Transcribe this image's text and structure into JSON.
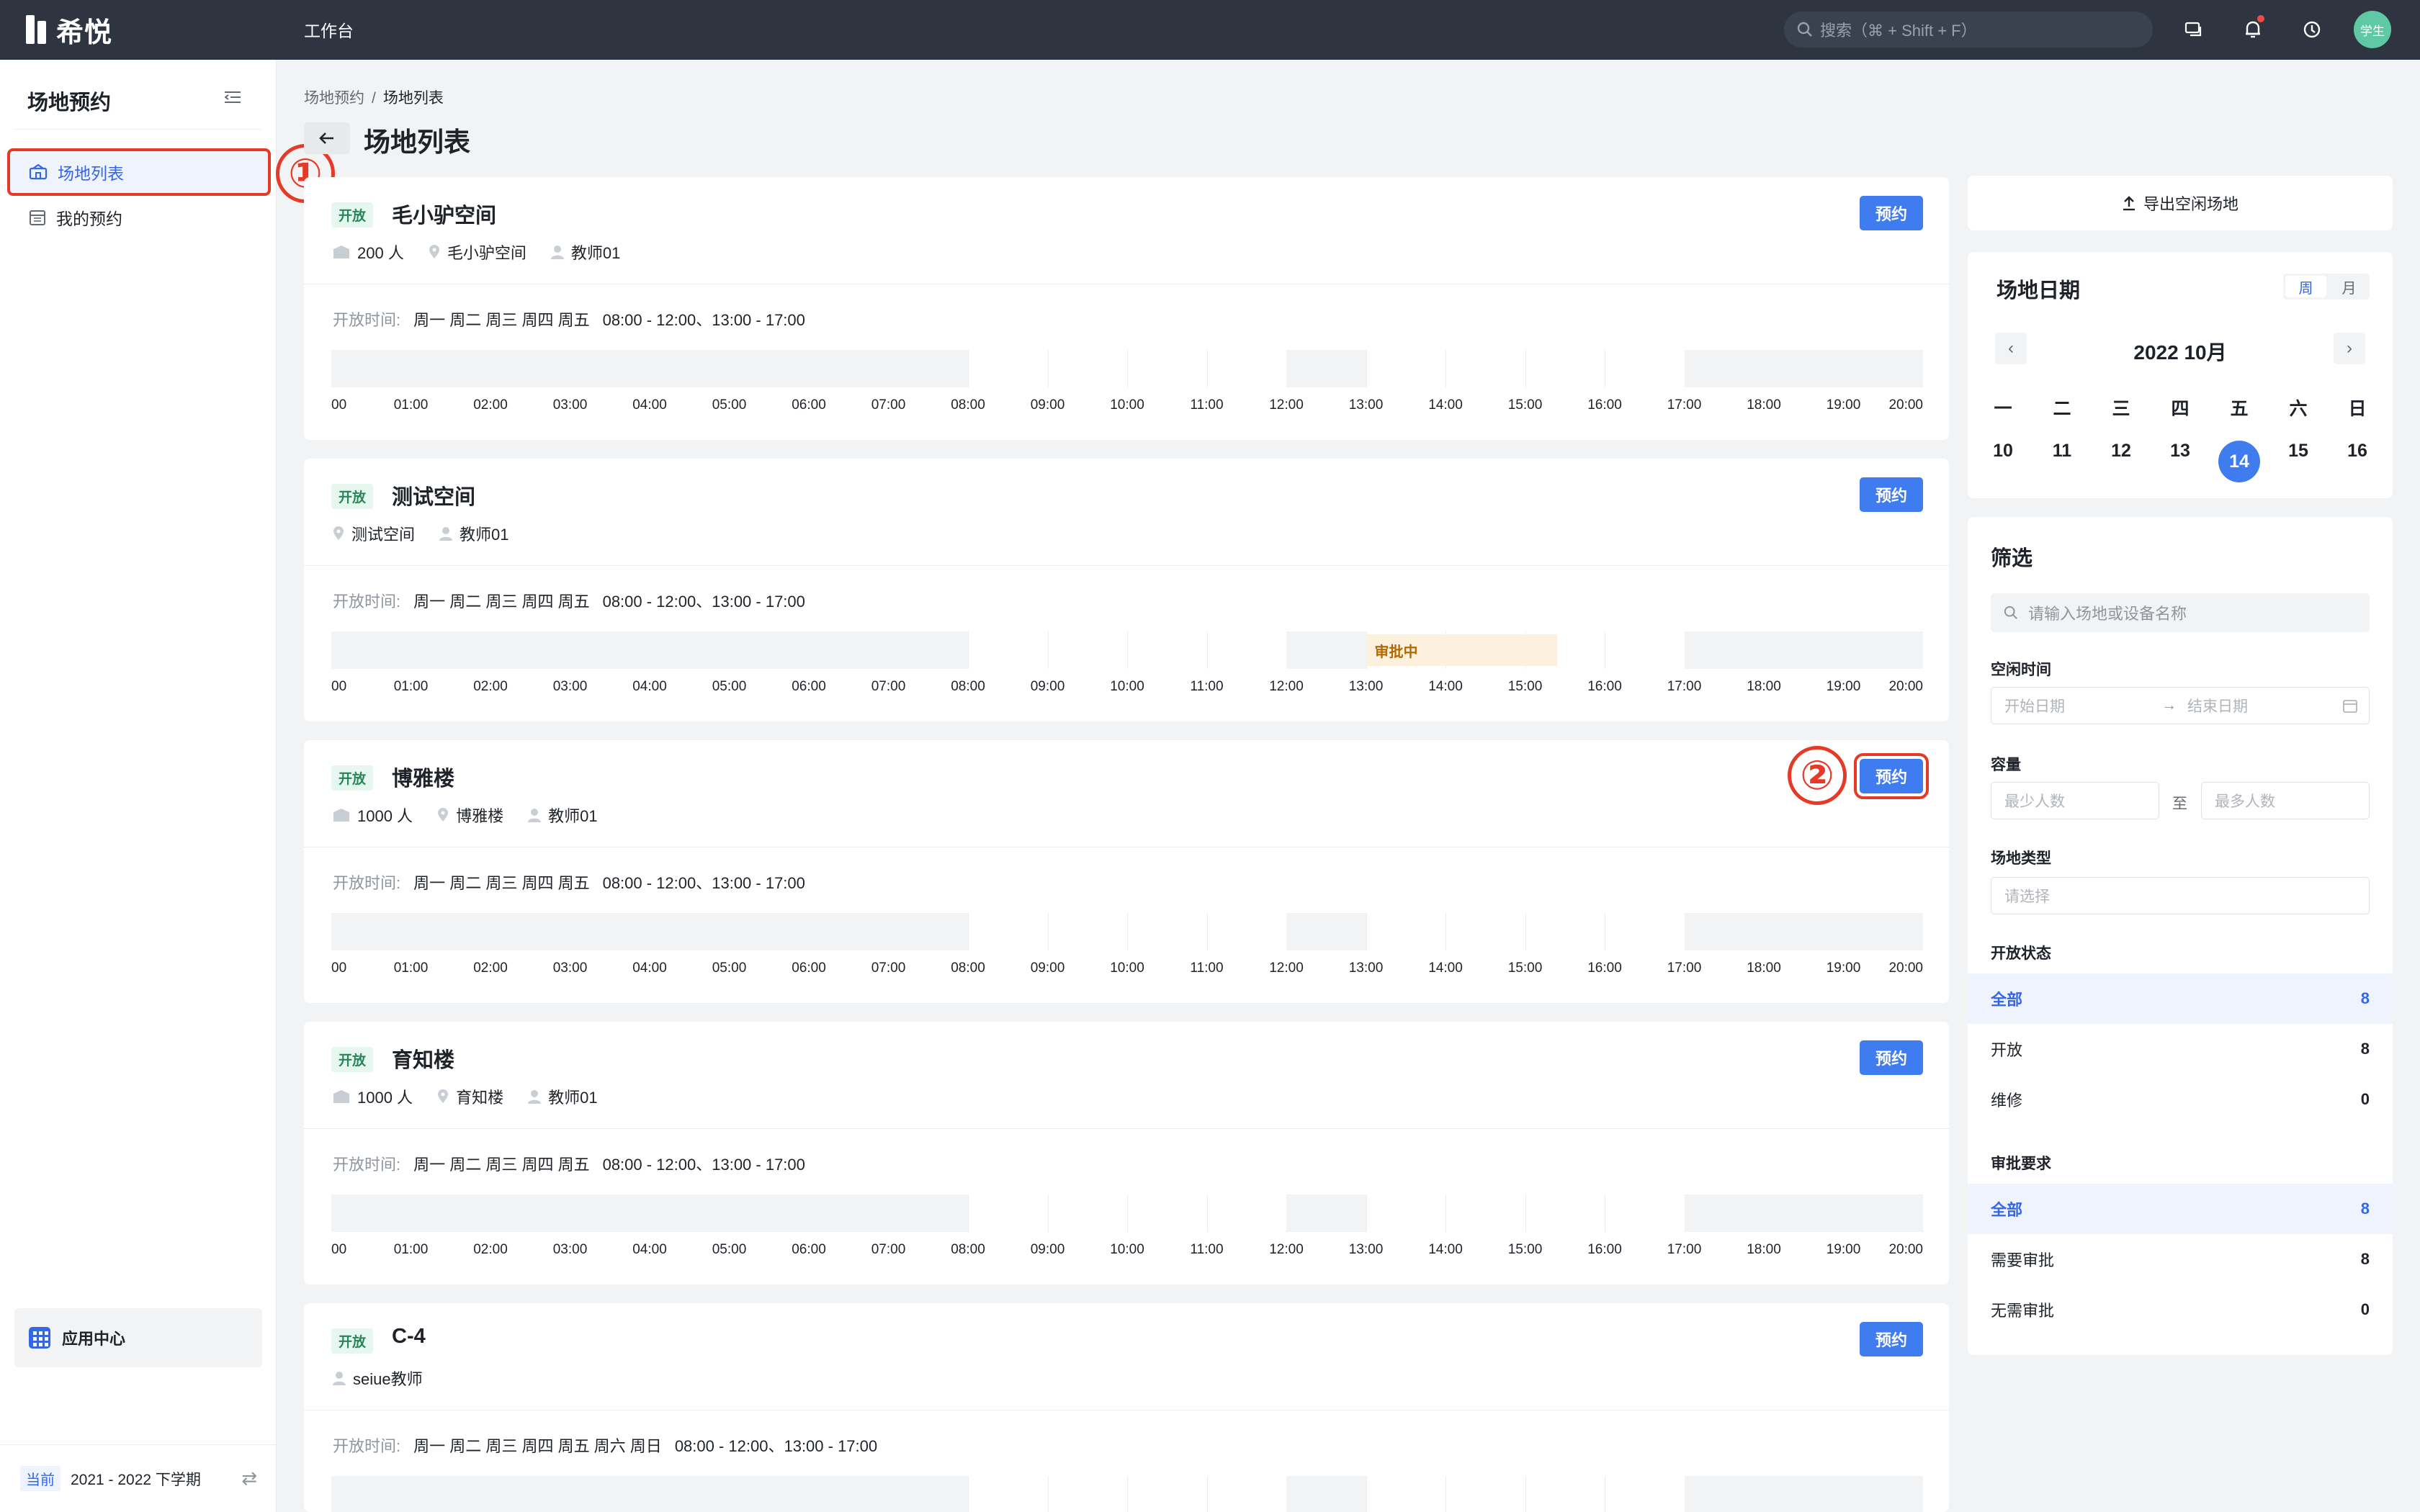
{
  "topbar": {
    "logo_text": "希悦",
    "nav_label": "工作台",
    "search_placeholder": "搜索（⌘ + Shift + F）",
    "avatar_text": "学生"
  },
  "sidebar": {
    "title": "场地预约",
    "items": [
      {
        "label": "场地列表",
        "active": true
      },
      {
        "label": "我的预约",
        "active": false
      }
    ],
    "app_center": "应用中心",
    "semester_badge": "当前",
    "semester": "2021 - 2022 下学期"
  },
  "annotations": [
    "①",
    "②"
  ],
  "breadcrumb": [
    "场地预约",
    "场地列表"
  ],
  "page_title": "场地列表",
  "venues": [
    {
      "status": "开放",
      "name": "毛小驴空间",
      "capacity": "200 人",
      "location": "毛小驴空间",
      "admin": "教师01",
      "open_label": "开放时间:",
      "days": "周一 周二 周三 周四 周五",
      "hours": "08:00 - 12:00、13:00 - 17:00",
      "pending": null,
      "book": "预约"
    },
    {
      "status": "开放",
      "name": "测试空间",
      "capacity": null,
      "location": "测试空间",
      "admin": "教师01",
      "open_label": "开放时间:",
      "days": "周一 周二 周三 周四 周五",
      "hours": "08:00 - 12:00、13:00 - 17:00",
      "pending": "审批中",
      "book": "预约"
    },
    {
      "status": "开放",
      "name": "博雅楼",
      "capacity": "1000 人",
      "location": "博雅楼",
      "admin": "教师01",
      "open_label": "开放时间:",
      "days": "周一 周二 周三 周四 周五",
      "hours": "08:00 - 12:00、13:00 - 17:00",
      "pending": null,
      "book": "预约"
    },
    {
      "status": "开放",
      "name": "育知楼",
      "capacity": "1000 人",
      "location": "育知楼",
      "admin": "教师01",
      "open_label": "开放时间:",
      "days": "周一 周二 周三 周四 周五",
      "hours": "08:00 - 12:00、13:00 - 17:00",
      "pending": null,
      "book": "预约"
    },
    {
      "status": "开放",
      "name": "C-4",
      "capacity": null,
      "location": null,
      "admin": "seiue教师",
      "open_label": "开放时间:",
      "days": "周一 周二 周三 周四 周五 周六 周日",
      "hours": "08:00 - 12:00、13:00 - 17:00",
      "pending": null,
      "book": "预约"
    }
  ],
  "ticks": [
    "00",
    "01:00",
    "02:00",
    "03:00",
    "04:00",
    "05:00",
    "06:00",
    "07:00",
    "08:00",
    "09:00",
    "10:00",
    "11:00",
    "12:00",
    "13:00",
    "14:00",
    "15:00",
    "16:00",
    "17:00",
    "18:00",
    "19:00",
    "20:00"
  ],
  "right": {
    "export": "导出空闲场地",
    "calendar": {
      "title": "场地日期",
      "toggle_week": "周",
      "toggle_month": "月",
      "month": "2022 10月",
      "weekdays": [
        "一",
        "二",
        "三",
        "四",
        "五",
        "六",
        "日"
      ],
      "days": [
        "10",
        "11",
        "12",
        "13",
        "14",
        "15",
        "16"
      ],
      "today": "14"
    },
    "filter": {
      "title": "筛选",
      "search_placeholder": "请输入场地或设备名称",
      "free_time_label": "空闲时间",
      "start_placeholder": "开始日期",
      "end_placeholder": "结束日期",
      "capacity_label": "容量",
      "min_placeholder": "最少人数",
      "to": "至",
      "max_placeholder": "最多人数",
      "type_label": "场地类型",
      "type_placeholder": "请选择",
      "status_label": "开放状态",
      "status_options": [
        {
          "label": "全部",
          "count": "8",
          "active": true
        },
        {
          "label": "开放",
          "count": "8",
          "active": false
        },
        {
          "label": "维修",
          "count": "0",
          "active": false
        }
      ],
      "approval_label": "审批要求",
      "approval_options": [
        {
          "label": "全部",
          "count": "8",
          "active": true
        },
        {
          "label": "需要审批",
          "count": "8",
          "active": false
        },
        {
          "label": "无需审批",
          "count": "0",
          "active": false
        }
      ]
    }
  }
}
